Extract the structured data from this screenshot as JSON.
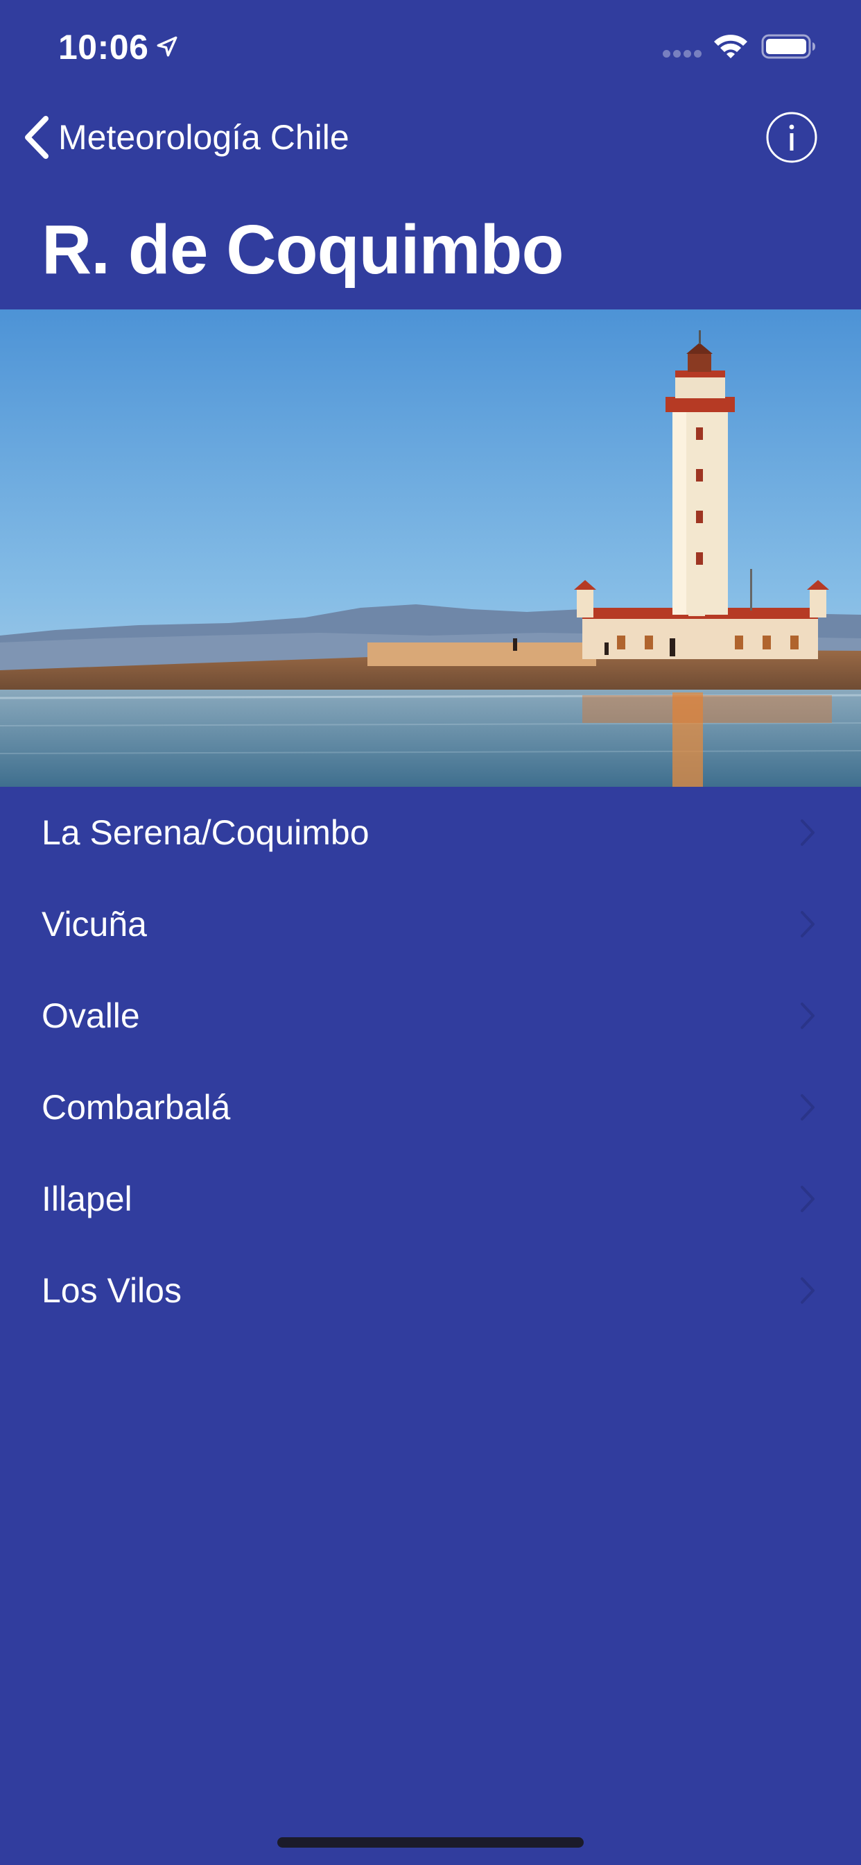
{
  "status_bar": {
    "time": "10:06",
    "icons": [
      "location-arrow-icon",
      "cellular-signal-icon",
      "wifi-icon",
      "battery-icon"
    ]
  },
  "nav": {
    "back_label": "Meteorología Chile",
    "back_icon": "chevron-left-icon",
    "info_icon": "info-circle-icon"
  },
  "title": "R. de Coquimbo",
  "header_image": {
    "subject": "lighthouse"
  },
  "cities": [
    {
      "name": "La Serena/Coquimbo"
    },
    {
      "name": "Vicuña"
    },
    {
      "name": "Ovalle"
    },
    {
      "name": "Combarbalá"
    },
    {
      "name": "Illapel"
    },
    {
      "name": "Los Vilos"
    }
  ],
  "colors": {
    "background": "#313d9e",
    "text": "#ffffff",
    "disclosure": "#2a3489",
    "home_indicator": "#1b1b2a"
  }
}
